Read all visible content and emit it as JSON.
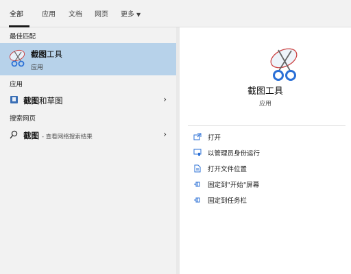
{
  "tabs": [
    {
      "label": "全部"
    },
    {
      "label": "应用"
    },
    {
      "label": "文档"
    },
    {
      "label": "网页"
    },
    {
      "label": "更多"
    }
  ],
  "left": {
    "best_match_title": "最佳匹配",
    "best_match": {
      "name_bold": "截图",
      "name_rest": "工具",
      "type": "应用"
    },
    "apps_title": "应用",
    "apps": [
      {
        "name_bold": "截图",
        "name_rest": "和草图"
      }
    ],
    "web_title": "搜索网页",
    "web": {
      "query": "截图",
      "hint": "- 查看网络搜索结果"
    }
  },
  "right": {
    "title": "截图工具",
    "subtitle": "应用",
    "actions": [
      {
        "label": "打开",
        "icon": "open-icon"
      },
      {
        "label": "以管理员身份运行",
        "icon": "run-as-admin-icon"
      },
      {
        "label": "打开文件位置",
        "icon": "file-location-icon"
      },
      {
        "label": "固定到\"开始\"屏幕",
        "icon": "pin-icon"
      },
      {
        "label": "固定到任务栏",
        "icon": "pin-icon"
      }
    ]
  },
  "colors": {
    "selected_bg": "#b7d2ea",
    "panel_bg": "#f2f2f2",
    "detail_bg": "#ffffff"
  }
}
